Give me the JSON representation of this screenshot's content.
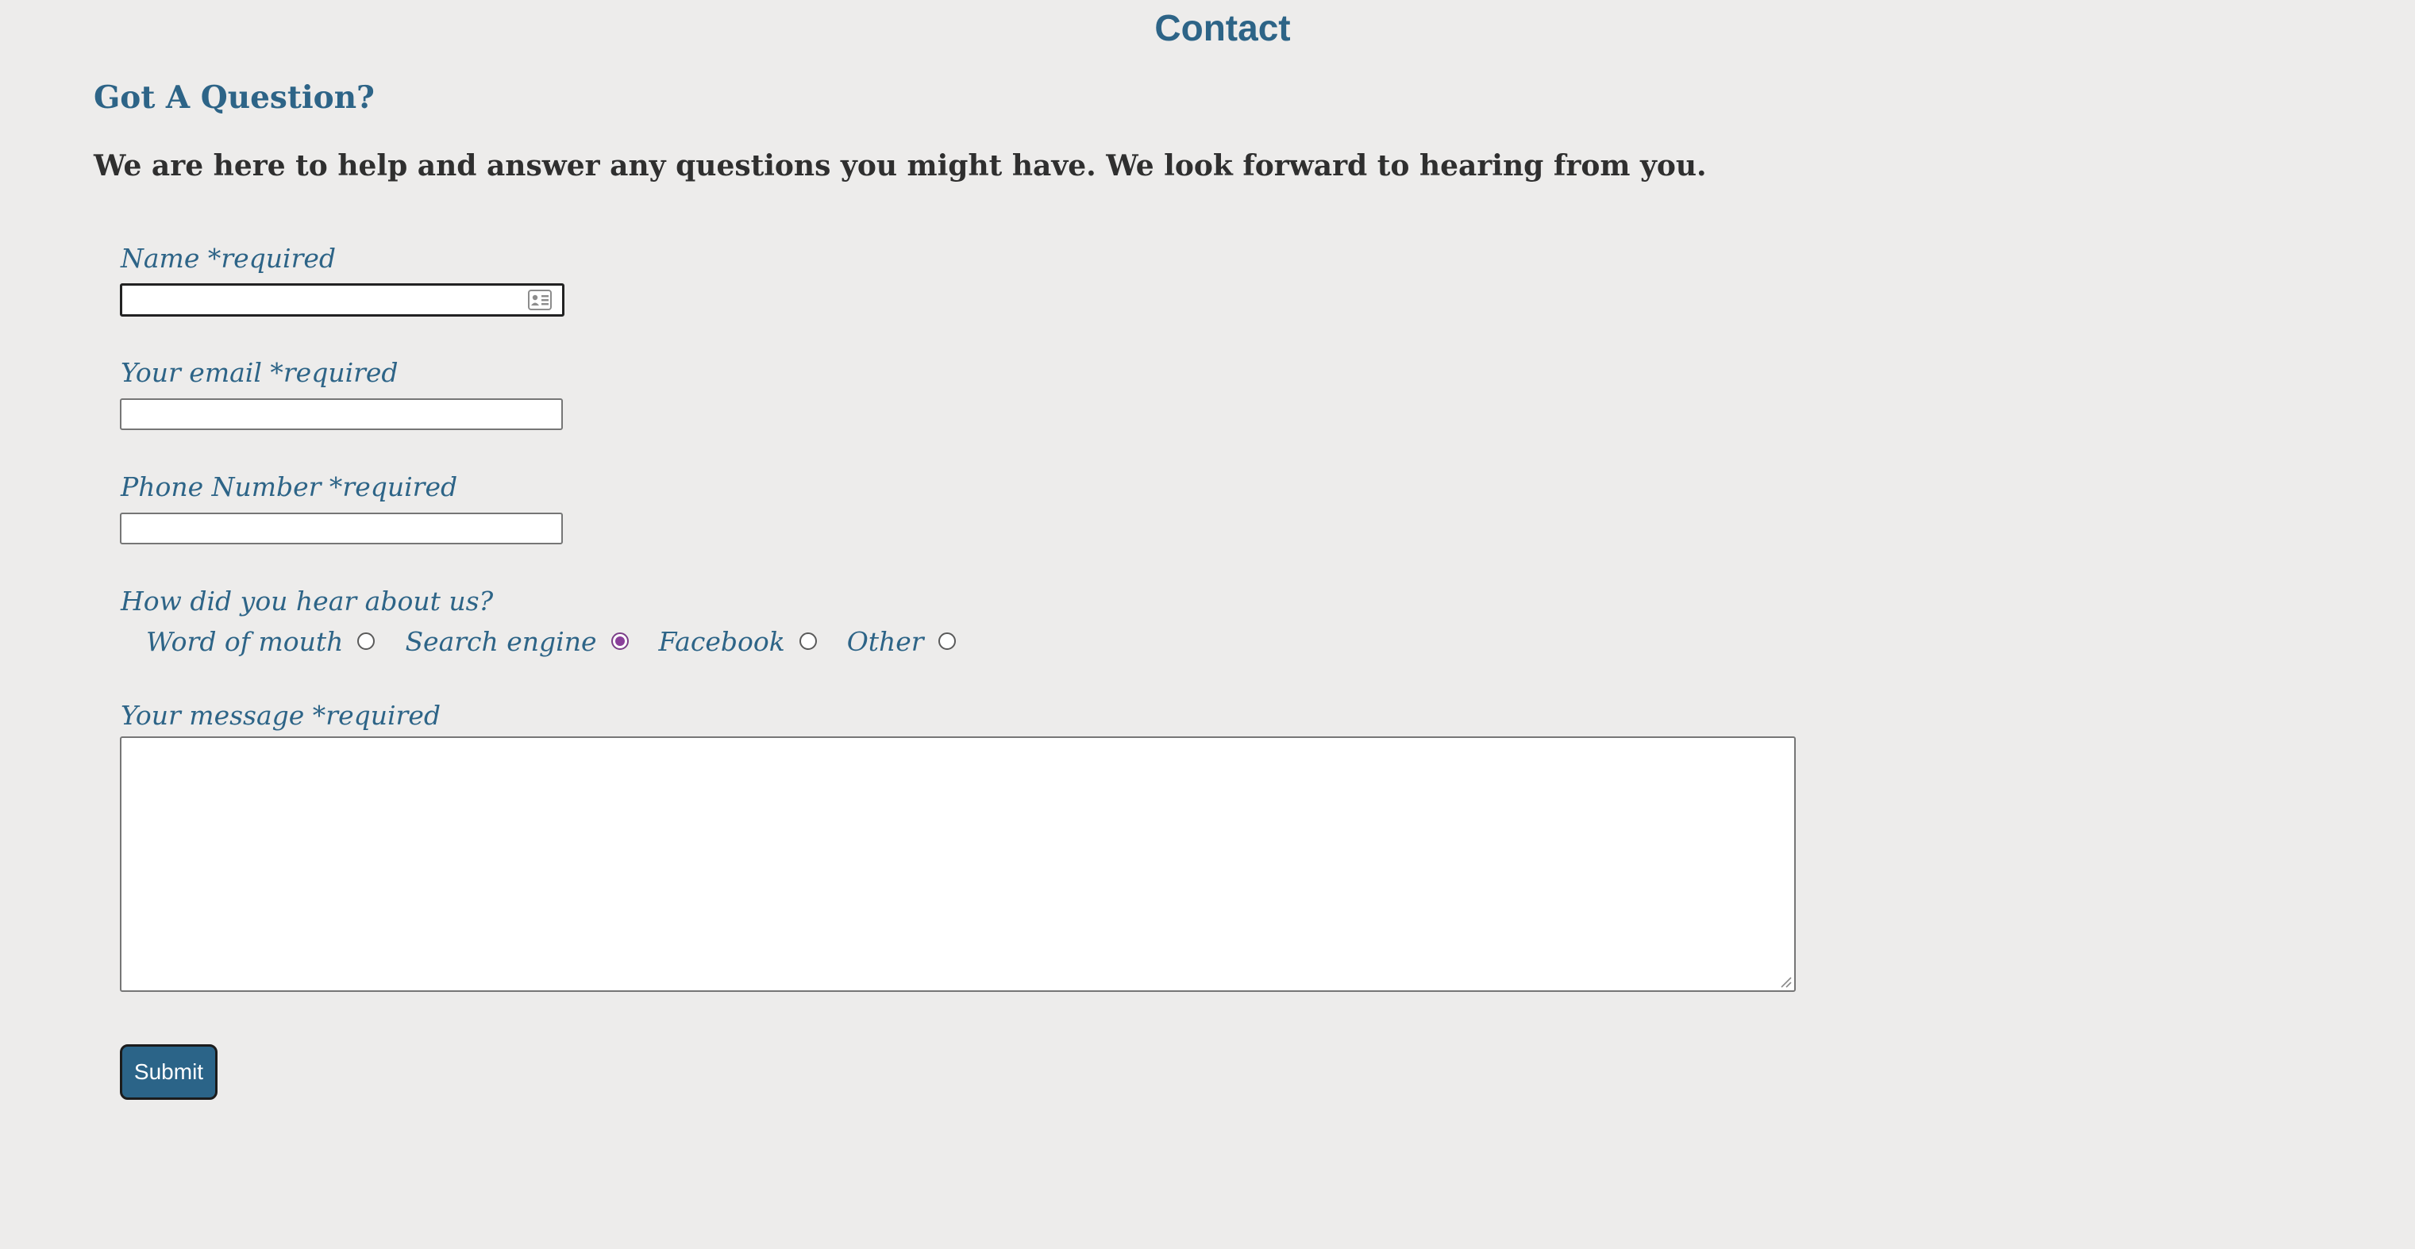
{
  "page": {
    "heading": "Contact",
    "section_title": "Got A Question?",
    "intro": "We are here to help and answer any questions you might have. We look forward to hearing from you."
  },
  "form": {
    "name_label": "Name *required",
    "name_value": "",
    "email_label": "Your email *required",
    "email_value": "",
    "phone_label": "Phone Number *required",
    "phone_value": "",
    "heard_label": "How did you hear about us?",
    "heard_options": [
      {
        "label": "Word of mouth",
        "checked": false
      },
      {
        "label": "Search engine",
        "checked": true
      },
      {
        "label": "Facebook",
        "checked": false
      },
      {
        "label": "Other",
        "checked": false
      }
    ],
    "message_label": "Your message *required",
    "message_value": "",
    "submit_label": "Submit"
  },
  "icons": {
    "name_field_icon": "contact-card-icon"
  },
  "colors": {
    "background": "#edeceb",
    "accent": "#2d6487",
    "intro_text": "#2f2f2f",
    "radio_checked": "#8a3f9a",
    "button": "#2b6488"
  }
}
